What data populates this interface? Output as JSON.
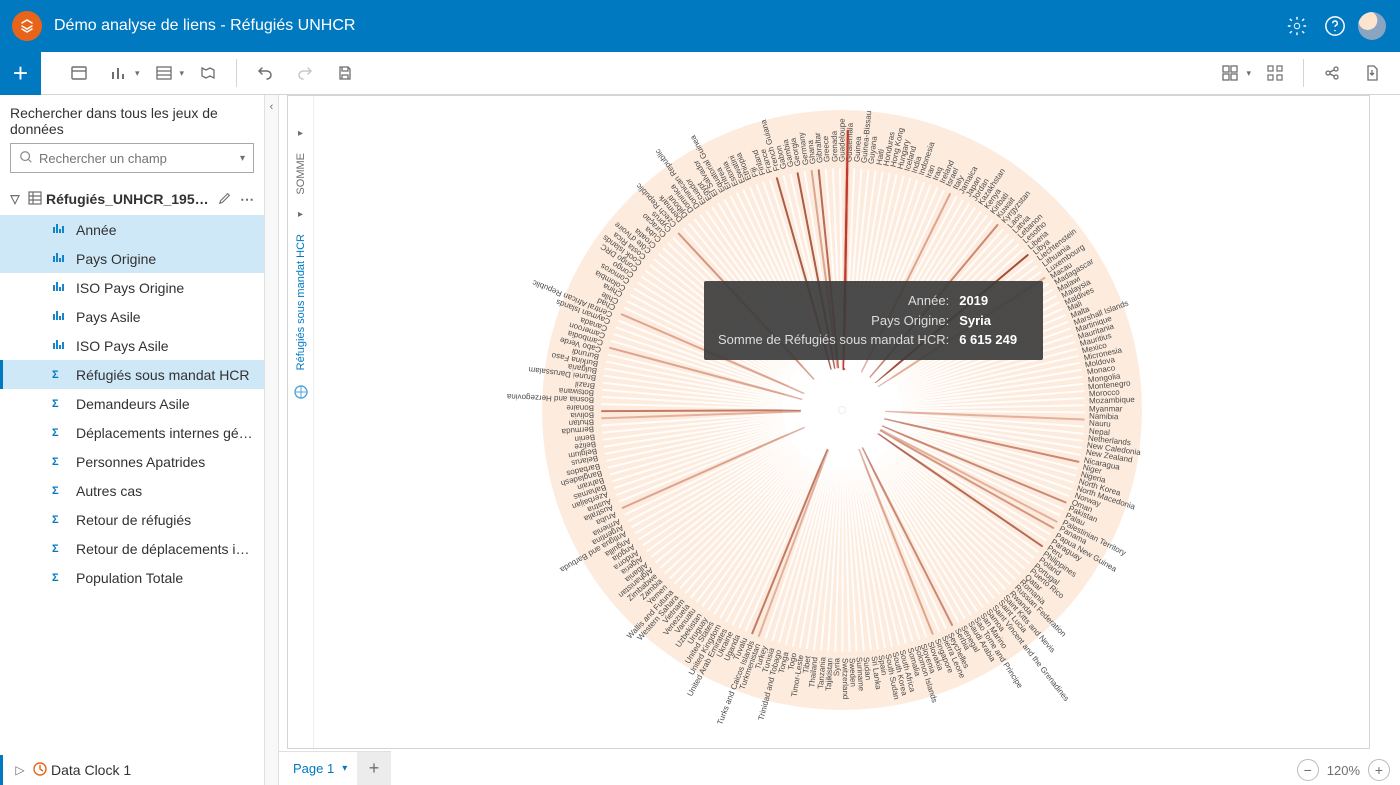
{
  "header": {
    "title": "Démo analyse de liens - Réfugiés UNHCR"
  },
  "ribbon": {},
  "sidebar": {
    "search_title": "Rechercher dans tous les jeux de données",
    "search_placeholder": "Rechercher un champ",
    "dataset_name": "Réfugiés_UNHCR_1951…",
    "fields": [
      {
        "label": "Année",
        "type": "str",
        "state": "sel"
      },
      {
        "label": "Pays Origine",
        "type": "str",
        "state": "sel"
      },
      {
        "label": "ISO Pays Origine",
        "type": "str",
        "state": ""
      },
      {
        "label": "Pays Asile",
        "type": "str",
        "state": ""
      },
      {
        "label": "ISO Pays Asile",
        "type": "str",
        "state": ""
      },
      {
        "label": "Réfugiés sous mandat HCR",
        "type": "num",
        "state": "sel-strong"
      },
      {
        "label": "Demandeurs Asile",
        "type": "num",
        "state": ""
      },
      {
        "label": "Déplacements internes gérés …",
        "type": "num",
        "state": ""
      },
      {
        "label": "Personnes Apatrides",
        "type": "num",
        "state": ""
      },
      {
        "label": "Autres cas",
        "type": "num",
        "state": ""
      },
      {
        "label": "Retour de réfugiés",
        "type": "num",
        "state": ""
      },
      {
        "label": "Retour de déplacements inter…",
        "type": "num",
        "state": ""
      },
      {
        "label": "Population Totale",
        "type": "num",
        "state": ""
      }
    ],
    "card_item": "Data Clock 1"
  },
  "card": {
    "axis1": "SOMME",
    "axis2": "Réfugiés sous mandat HCR"
  },
  "tooltip": {
    "k1": "Année:",
    "v1": "2019",
    "k2": "Pays Origine:",
    "v2": "Syria",
    "k3": "Somme de Réfugiés sous mandat HCR:",
    "v3": "6 615 249"
  },
  "pager": {
    "tab": "Page 1"
  },
  "zoom": {
    "level": "120%"
  },
  "chart_data": {
    "type": "radial-heatmap",
    "title": "Data Clock 1",
    "angle_field": "Pays Origine",
    "radius_field": "Année",
    "value_field": "Somme de Réfugiés sous mandat HCR",
    "highlight": {
      "Année": "2019",
      "Pays Origine": "Syria",
      "value": 6615249
    },
    "countries": [
      "Afghanistan",
      "Albania",
      "Algeria",
      "Andorra",
      "Angola",
      "Anguilla",
      "Antigua and Barbuda",
      "Argentina",
      "Armenia",
      "Aruba",
      "Australia",
      "Austria",
      "Azerbaijan",
      "Bahamas",
      "Bahrain",
      "Bangladesh",
      "Barbados",
      "Belarus",
      "Belgium",
      "Belize",
      "Benin",
      "Bermuda",
      "Bhutan",
      "Bolivia",
      "Bonaire",
      "Bosnia and Herzegovina",
      "Botswana",
      "Brazil",
      "Brunei Darussalam",
      "Bulgaria",
      "Burkina Faso",
      "Burundi",
      "Cabo Verde",
      "Cambodia",
      "Cameroon",
      "Canada",
      "Cayman Islands",
      "Central African Republic",
      "Chad",
      "Chile",
      "China",
      "Colombia",
      "Comoros",
      "Congo",
      "Congo DRC",
      "Cook Islands",
      "Costa Rica",
      "Côte d'Ivoire",
      "Croatia",
      "Cuba",
      "Curaçao",
      "Cyprus",
      "Czech Republic",
      "Denmark",
      "Djibouti",
      "Dominica",
      "Dominican Republic",
      "Ecuador",
      "Egypt",
      "El Salvador",
      "Equatorial Guinea",
      "Eritrea",
      "Estonia",
      "Eswatini",
      "Ethiopia",
      "Fiji",
      "Finland",
      "France",
      "French Guiana",
      "Gabon",
      "Gambia",
      "Georgia",
      "Germany",
      "Ghana",
      "Gibraltar",
      "Greece",
      "Grenada",
      "Guadeloupe",
      "Guatemala",
      "Guinea",
      "Guinea-Bissau",
      "Guyana",
      "Haiti",
      "Honduras",
      "Hong Kong",
      "Hungary",
      "Iceland",
      "India",
      "Indonesia",
      "Iran",
      "Iraq",
      "Ireland",
      "Israel",
      "Italy",
      "Jamaica",
      "Japan",
      "Jordan",
      "Kazakhstan",
      "Kenya",
      "Kiribati",
      "Kuwait",
      "Kyrgyzstan",
      "Laos",
      "Latvia",
      "Lebanon",
      "Lesotho",
      "Liberia",
      "Libya",
      "Liechtenstein",
      "Lithuania",
      "Luxembourg",
      "Macau",
      "Madagascar",
      "Malawi",
      "Malaysia",
      "Maldives",
      "Mali",
      "Malta",
      "Marshall Islands",
      "Martinique",
      "Mauritania",
      "Mauritius",
      "Mexico",
      "Micronesia",
      "Moldova",
      "Monaco",
      "Mongolia",
      "Montenegro",
      "Morocco",
      "Mozambique",
      "Myanmar",
      "Namibia",
      "Nauru",
      "Nepal",
      "Netherlands",
      "New Caledonia",
      "New Zealand",
      "Nicaragua",
      "Niger",
      "Nigeria",
      "North Korea",
      "North Macedonia",
      "Norway",
      "Oman",
      "Pakistan",
      "Palau",
      "Palestinian Territory",
      "Panama",
      "Papua New Guinea",
      "Paraguay",
      "Peru",
      "Philippines",
      "Poland",
      "Portugal",
      "Puerto Rico",
      "Qatar",
      "Romania",
      "Russian Federation",
      "Rwanda",
      "Saint Kitts and Nevis",
      "Saint Lucia",
      "Saint Vincent and the Grenadines",
      "Samoa",
      "San Marino",
      "Sao Tome and Principe",
      "Saudi Arabia",
      "Senegal",
      "Serbia",
      "Seychelles",
      "Sierra Leone",
      "Singapore",
      "Slovakia",
      "Slovenia",
      "Solomon Islands",
      "Somalia",
      "South Africa",
      "South Korea",
      "South Sudan",
      "Spain",
      "Sri Lanka",
      "Sudan",
      "Suriname",
      "Sweden",
      "Switzerland",
      "Syria",
      "Tajikistan",
      "Tanzania",
      "Thailand",
      "Tibet",
      "Timor-Leste",
      "Togo",
      "Tonga",
      "Trinidad and Tobago",
      "Tunisia",
      "Turkey",
      "Turkmenistan",
      "Turks and Caicos Islands",
      "Tuvalu",
      "Uganda",
      "Ukraine",
      "United Arab Emirates",
      "United Kingdom",
      "United States",
      "Uruguay",
      "Uzbekistan",
      "Vanuatu",
      "Venezuela",
      "Vietnam",
      "Western Sahara",
      "Wallis and Futuna",
      "Yemen",
      "Zambia",
      "Zimbabwe"
    ],
    "intensity_examples_10pt_scale": {
      "Syria": 10,
      "Afghanistan": 9,
      "South Sudan": 8,
      "Somalia": 8,
      "Sudan": 7,
      "Congo DRC": 7,
      "Myanmar": 6,
      "Iraq": 6,
      "Eritrea": 5,
      "Burundi": 5,
      "Central African Republic": 5,
      "Vietnam": 5,
      "Colombia": 4,
      "Rwanda": 4,
      "Mali": 3,
      "Nigeria": 3,
      "Ukraine": 3,
      "Pakistan": 3,
      "Ethiopia": 3,
      "Sri Lanka": 3,
      "China": 2,
      "Iran": 2,
      "Bosnia and Herzegovina": 2,
      "Angola": 2,
      "Mozambique": 2
    }
  }
}
